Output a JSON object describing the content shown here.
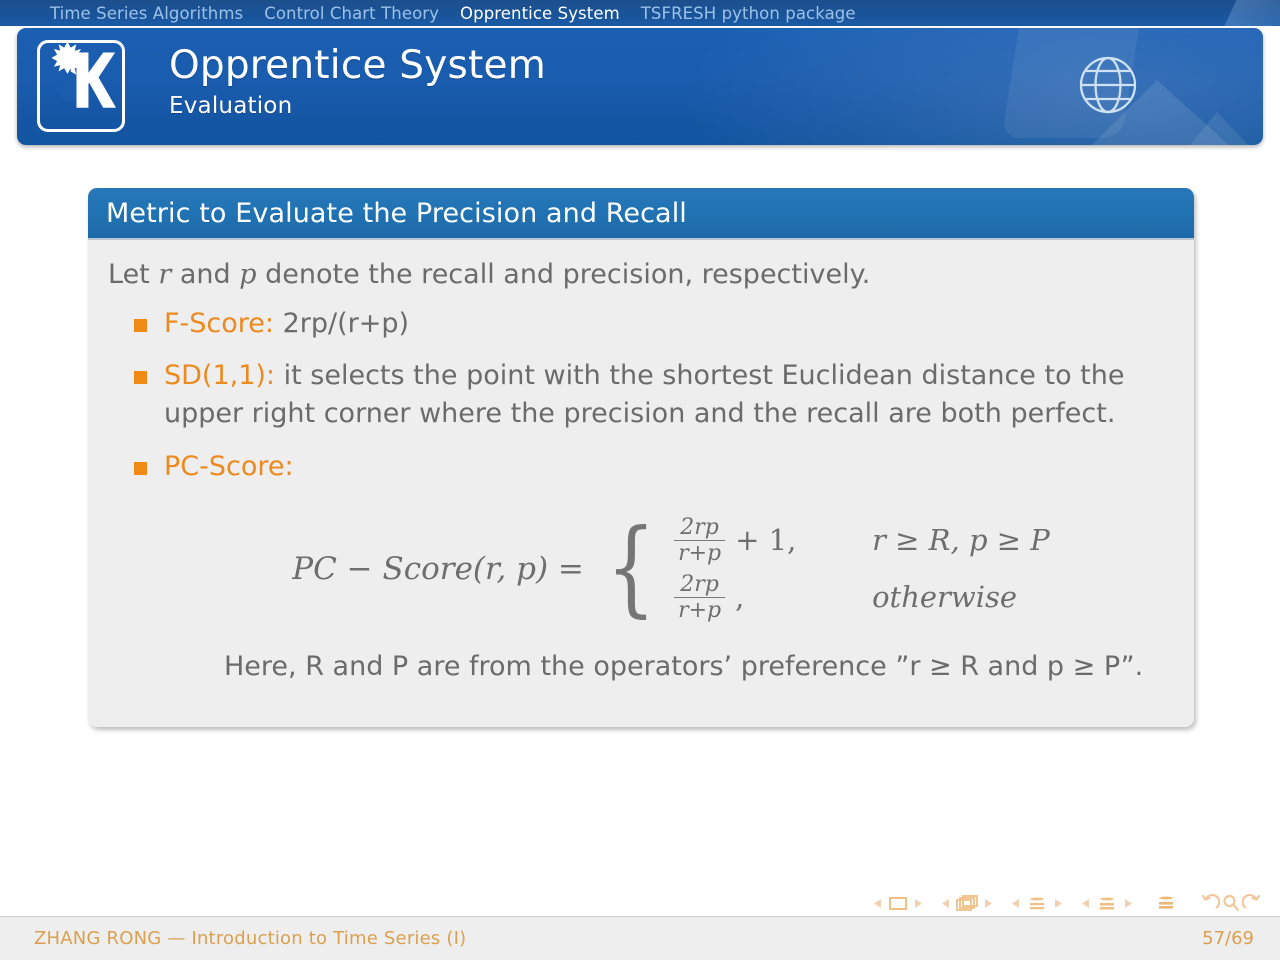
{
  "navbar": {
    "items": [
      {
        "label": "Time Series Algorithms",
        "active": false
      },
      {
        "label": "Control Chart Theory",
        "active": false
      },
      {
        "label": "Opprentice System",
        "active": true
      },
      {
        "label": "TSFRESH python package",
        "active": false
      }
    ]
  },
  "header": {
    "title": "Opprentice System",
    "subtitle": "Evaluation",
    "logo_icon": "kde-gear-k-logo",
    "globe_icon": "globe-icon"
  },
  "block": {
    "title": "Metric to Evaluate the Precision and Recall",
    "lead_prefix": "Let ",
    "lead_var1": "r",
    "lead_mid": " and ",
    "lead_var2": "p",
    "lead_suffix": " denote the recall and precision, respectively.",
    "bullets": [
      {
        "label": "F-Score:",
        "text": " 2rp/(r+p)"
      },
      {
        "label": "SD(1,1):",
        "text": " it selects the point with the shortest Euclidean distance to the upper right corner where the precision and the recall are both perfect."
      },
      {
        "label": "PC-Score:",
        "text": ""
      }
    ]
  },
  "formula": {
    "lhs": "PC − Score(r, p) =",
    "cases": [
      {
        "numerator": "2rp",
        "denominator": "r+p",
        "tail": "+ 1,",
        "condition": "r ≥ R, p ≥ P"
      },
      {
        "numerator": "2rp",
        "denominator": "r+p",
        "tail": ",",
        "condition": "otherwise"
      }
    ]
  },
  "closing": {
    "text": "Here, R and P are from the operators’ preference ”r ≥ R and p ≥ P”."
  },
  "navigation_symbols": {
    "icons": [
      "prev-slide-icon",
      "slide-icon",
      "next-slide-icon",
      "prev-frame-icon",
      "frames-icon",
      "next-frame-icon",
      "prev-subsection-icon",
      "subsection-icon",
      "next-subsection-icon",
      "prev-section-icon",
      "section-icon",
      "next-section-icon",
      "document-icon",
      "back-icon",
      "search-icon",
      "forward-icon"
    ]
  },
  "footer": {
    "author_title": "ZHANG RONG — Introduction to Time Series (I)",
    "page": "57/69"
  },
  "colors": {
    "nav_bg": "#1b5aa6",
    "title_bg": "#1a5cae",
    "block_title_bg": "#2073b4",
    "block_body_bg": "#efeeee",
    "bullet_orange": "#f08a16",
    "label_orange": "#eb8a1e",
    "body_text": "#6b6b6b",
    "footer_text": "#d9a04f"
  }
}
